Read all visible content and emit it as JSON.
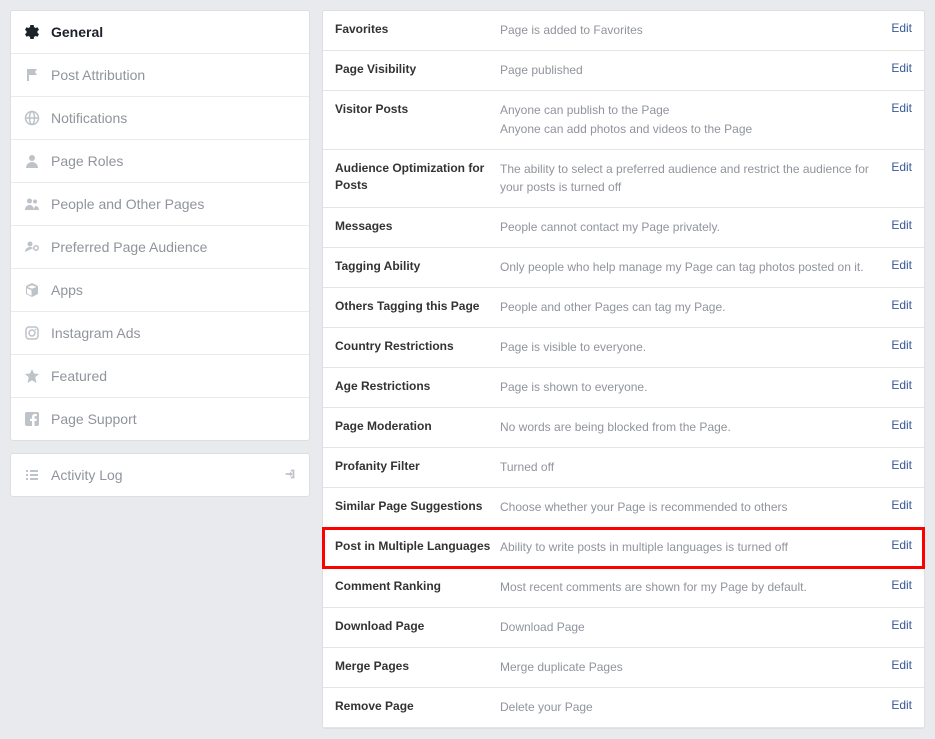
{
  "sidebar": {
    "items": [
      {
        "label": "General",
        "icon": "gear",
        "active": true
      },
      {
        "label": "Post Attribution",
        "icon": "flag"
      },
      {
        "label": "Notifications",
        "icon": "globe"
      },
      {
        "label": "Page Roles",
        "icon": "person"
      },
      {
        "label": "People and Other Pages",
        "icon": "people"
      },
      {
        "label": "Preferred Page Audience",
        "icon": "target"
      },
      {
        "label": "Apps",
        "icon": "box"
      },
      {
        "label": "Instagram Ads",
        "icon": "camera"
      },
      {
        "label": "Featured",
        "icon": "star"
      },
      {
        "label": "Page Support",
        "icon": "fb"
      }
    ],
    "activity_log": {
      "label": "Activity Log"
    }
  },
  "settings": [
    {
      "label": "Favorites",
      "value": [
        "Page is added to Favorites"
      ],
      "edit": "Edit"
    },
    {
      "label": "Page Visibility",
      "value": [
        "Page published"
      ],
      "edit": "Edit"
    },
    {
      "label": "Visitor Posts",
      "value": [
        "Anyone can publish to the Page",
        "Anyone can add photos and videos to the Page"
      ],
      "edit": "Edit"
    },
    {
      "label": "Audience Optimization for Posts",
      "value": [
        "The ability to select a preferred audience and restrict the audience for your posts is turned off"
      ],
      "edit": "Edit"
    },
    {
      "label": "Messages",
      "value": [
        "People cannot contact my Page privately."
      ],
      "edit": "Edit"
    },
    {
      "label": "Tagging Ability",
      "value": [
        "Only people who help manage my Page can tag photos posted on it."
      ],
      "edit": "Edit"
    },
    {
      "label": "Others Tagging this Page",
      "value": [
        "People and other Pages can tag my Page."
      ],
      "edit": "Edit"
    },
    {
      "label": "Country Restrictions",
      "value": [
        "Page is visible to everyone."
      ],
      "edit": "Edit"
    },
    {
      "label": "Age Restrictions",
      "value": [
        "Page is shown to everyone."
      ],
      "edit": "Edit"
    },
    {
      "label": "Page Moderation",
      "value": [
        "No words are being blocked from the Page."
      ],
      "edit": "Edit"
    },
    {
      "label": "Profanity Filter",
      "value": [
        "Turned off"
      ],
      "edit": "Edit"
    },
    {
      "label": "Similar Page Suggestions",
      "value": [
        "Choose whether your Page is recommended to others"
      ],
      "edit": "Edit"
    },
    {
      "label": "Post in Multiple Languages",
      "value": [
        "Ability to write posts in multiple languages is turned off"
      ],
      "edit": "Edit",
      "highlight": true
    },
    {
      "label": "Comment Ranking",
      "value": [
        "Most recent comments are shown for my Page by default."
      ],
      "edit": "Edit"
    },
    {
      "label": "Download Page",
      "value": [
        "Download Page"
      ],
      "edit": "Edit"
    },
    {
      "label": "Merge Pages",
      "value": [
        "Merge duplicate Pages"
      ],
      "edit": "Edit"
    },
    {
      "label": "Remove Page",
      "value": [
        "Delete your Page"
      ],
      "edit": "Edit"
    }
  ]
}
